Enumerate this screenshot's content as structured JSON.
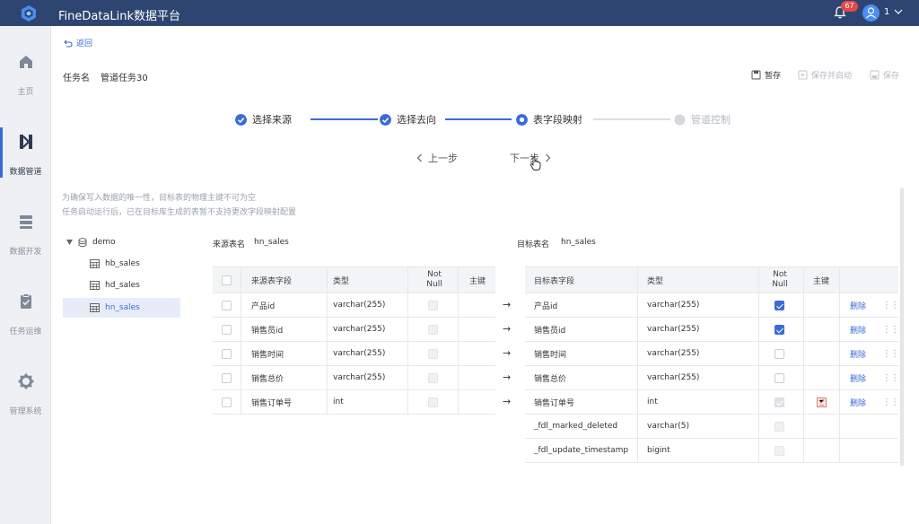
{
  "app": {
    "title": "FineDataLink数据平台",
    "notification_count": "67",
    "user_name": "1"
  },
  "sidebar": {
    "items": [
      {
        "label": "主页",
        "icon": "home-icon"
      },
      {
        "label": "数据管道",
        "icon": "pipeline-icon",
        "active": true
      },
      {
        "label": "数据开发",
        "icon": "dev-icon"
      },
      {
        "label": "任务运维",
        "icon": "clipboard-icon"
      },
      {
        "label": "管理系统",
        "icon": "gear-icon"
      }
    ]
  },
  "header": {
    "back_label": "返回",
    "task_label": "任务名",
    "task_name": "管道任务30",
    "pause_label": "暂存",
    "save_start_label": "保存并启动",
    "save_label": "保存"
  },
  "steps": [
    {
      "label": "选择来源",
      "state": "done"
    },
    {
      "label": "选择去向",
      "state": "done"
    },
    {
      "label": "表字段映射",
      "state": "current"
    },
    {
      "label": "管道控制",
      "state": "pending"
    }
  ],
  "nav": {
    "prev_label": "上一步",
    "next_label": "下一步"
  },
  "notes": [
    "为确保写入数据的唯一性，目标表的物理主键不可为空",
    "任务启动运行后，已在目标库生成的表暂不支持更改字段映射配置"
  ],
  "tree": {
    "root": "demo",
    "items": [
      "hb_sales",
      "hd_sales",
      "hn_sales"
    ],
    "selected": "hn_sales"
  },
  "source_table": {
    "caption_label": "来源表名",
    "caption_value": "hn_sales",
    "columns": [
      "来源表字段",
      "类型",
      "Not Null",
      "主键"
    ],
    "rows": [
      {
        "field": "产品id",
        "type": "varchar(255)"
      },
      {
        "field": "销售员id",
        "type": "varchar(255)"
      },
      {
        "field": "销售时间",
        "type": "varchar(255)"
      },
      {
        "field": "销售总价",
        "type": "varchar(255)"
      },
      {
        "field": "销售订单号",
        "type": "int"
      }
    ]
  },
  "target_table": {
    "caption_label": "目标表名",
    "caption_value": "hn_sales",
    "columns": [
      "目标表字段",
      "类型",
      "Not Null",
      "主键"
    ],
    "delete_label": "删除",
    "rows": [
      {
        "field": "产品id",
        "type": "varchar(255)",
        "not_null": "checked",
        "pk": false,
        "deletable": true
      },
      {
        "field": "销售员id",
        "type": "varchar(255)",
        "not_null": "checked",
        "pk": false,
        "deletable": true
      },
      {
        "field": "销售时间",
        "type": "varchar(255)",
        "not_null": "unchecked",
        "pk": false,
        "deletable": true
      },
      {
        "field": "销售总价",
        "type": "varchar(255)",
        "not_null": "unchecked",
        "pk": false,
        "deletable": true
      },
      {
        "field": "销售订单号",
        "type": "int",
        "not_null": "checked-disabled",
        "pk": true,
        "deletable": true
      },
      {
        "field": "_fdl_marked_deleted",
        "type": "varchar(5)",
        "not_null": "disabled",
        "pk": false,
        "deletable": false
      },
      {
        "field": "_fdl_update_timestamp",
        "type": "bigint",
        "not_null": "disabled",
        "pk": false,
        "deletable": false
      }
    ]
  },
  "colors": {
    "topbar": "#2e4572",
    "accent": "#3a6cd6",
    "danger": "#e24a4a"
  }
}
